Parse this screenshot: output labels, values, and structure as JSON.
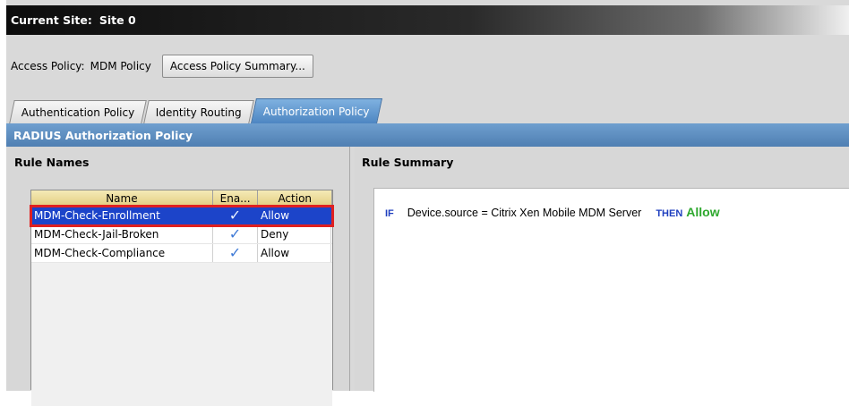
{
  "site_bar": {
    "label": "Current Site:",
    "value": "Site 0"
  },
  "access_policy": {
    "label": "Access Policy:",
    "value": "MDM Policy",
    "summary_button": "Access Policy Summary..."
  },
  "tabs": [
    {
      "label": "Authentication Policy",
      "active": false
    },
    {
      "label": "Identity Routing",
      "active": false
    },
    {
      "label": "Authorization Policy",
      "active": true
    }
  ],
  "section_header": "RADIUS Authorization Policy",
  "rule_names": {
    "title": "Rule Names",
    "columns": [
      "Name",
      "Ena...",
      "Action"
    ],
    "rows": [
      {
        "name": "MDM-Check-Enrollment",
        "enabled": "✓",
        "action": "Allow",
        "selected": true
      },
      {
        "name": "MDM-Check-Jail-Broken",
        "enabled": "✓",
        "action": "Deny",
        "selected": false
      },
      {
        "name": "MDM-Check-Compliance",
        "enabled": "✓",
        "action": "Allow",
        "selected": false
      }
    ]
  },
  "rule_summary": {
    "title": "Rule Summary",
    "if_keyword": "IF",
    "condition": "Device.source  =  Citrix Xen Mobile MDM Server",
    "then_keyword": "THEN",
    "result": "Allow"
  },
  "colors": {
    "tab_active": "#4d86c2",
    "header_bar": "#5b8bbd",
    "selected_row": "#1c44c9",
    "highlight_border": "#e02020",
    "allow_text": "#2ea82e",
    "keyword": "#1f3fbf"
  }
}
